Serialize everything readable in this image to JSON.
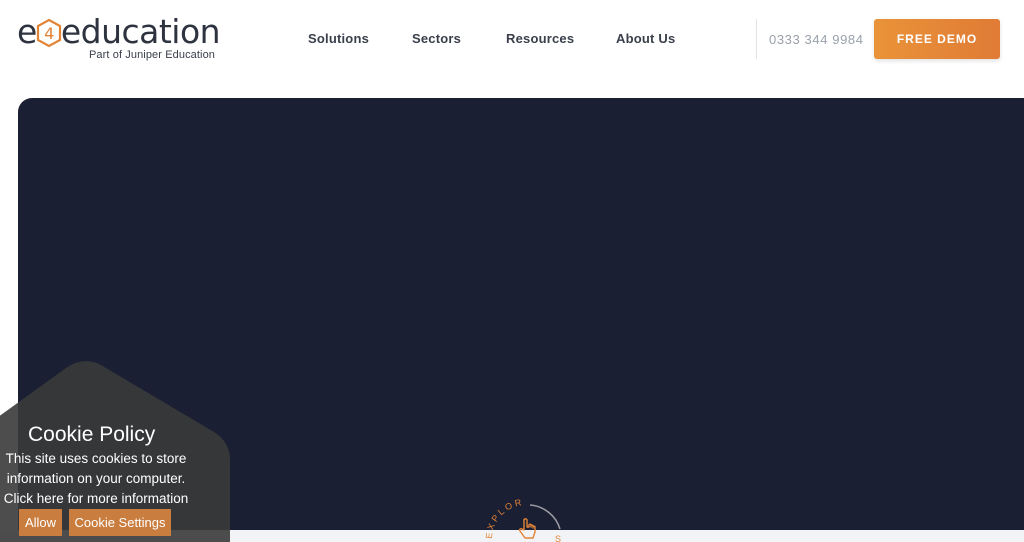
{
  "brand": {
    "logo_prefix": "e",
    "logo_digit": "4",
    "logo_suffix": "education",
    "tagline": "Part of Juniper Education",
    "colors": {
      "accent": "#e28436",
      "dark": "#1b1f33",
      "text": "#3a3f4b"
    }
  },
  "nav": {
    "items": [
      {
        "label": "Solutions"
      },
      {
        "label": "Sectors"
      },
      {
        "label": "Resources"
      },
      {
        "label": "About Us"
      }
    ]
  },
  "header": {
    "phone": "0333 344 9984",
    "demo_label": "FREE DEMO"
  },
  "hero": {
    "explore_text": "EXPLORE",
    "explore_icon": "pointing-hand-icon"
  },
  "cookie": {
    "title": "Cookie Policy",
    "lines": [
      "This site uses cookies to store",
      "information on your computer.",
      "Click here for more information"
    ],
    "allow_label": "Allow",
    "settings_label": "Cookie Settings"
  }
}
